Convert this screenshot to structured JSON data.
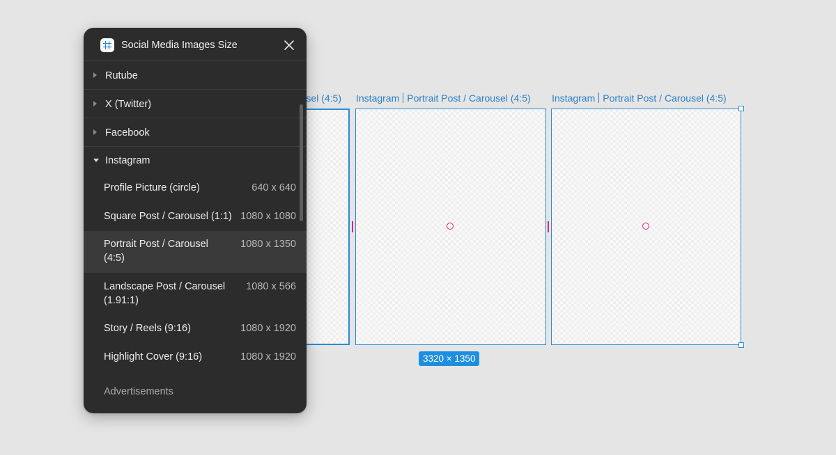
{
  "panel": {
    "title": "Social Media Images Size",
    "app_icon": "frame-grid-icon",
    "close_icon": "close-icon",
    "groups": [
      {
        "label": "Rutube",
        "expanded": false
      },
      {
        "label": "X (Twitter)",
        "expanded": false
      },
      {
        "label": "Facebook",
        "expanded": false
      },
      {
        "label": "Instagram",
        "expanded": true
      }
    ],
    "instagram_items": [
      {
        "name": "Profile Picture (circle)",
        "size": "640 x 640"
      },
      {
        "name": "Square Post / Carousel (1:1)",
        "size": "1080 x 1080"
      },
      {
        "name": "Portrait Post / Carousel (4:5)",
        "size": "1080 x 1350",
        "selected": true
      },
      {
        "name": "Landscape Post / Carousel (1.91:1)",
        "size": "1080 x 566"
      },
      {
        "name": "Story / Reels (9:16)",
        "size": "1080 x 1920"
      },
      {
        "name": "Highlight Cover (9:16)",
        "size": "1080 x 1920"
      }
    ],
    "section_label": "Advertisements"
  },
  "canvas": {
    "frame_labels": [
      {
        "text_partial": "sel (4:5)"
      },
      {
        "platform": "Instagram",
        "format": "Portrait Post / Carousel (4:5)"
      },
      {
        "platform": "Instagram",
        "format": "Portrait Post / Carousel (4:5)"
      }
    ],
    "selection_size": "3320 × 1350",
    "colors": {
      "selection": "#2a8bd6",
      "badge": "#1e8fe0",
      "guide": "#e0218a"
    }
  }
}
